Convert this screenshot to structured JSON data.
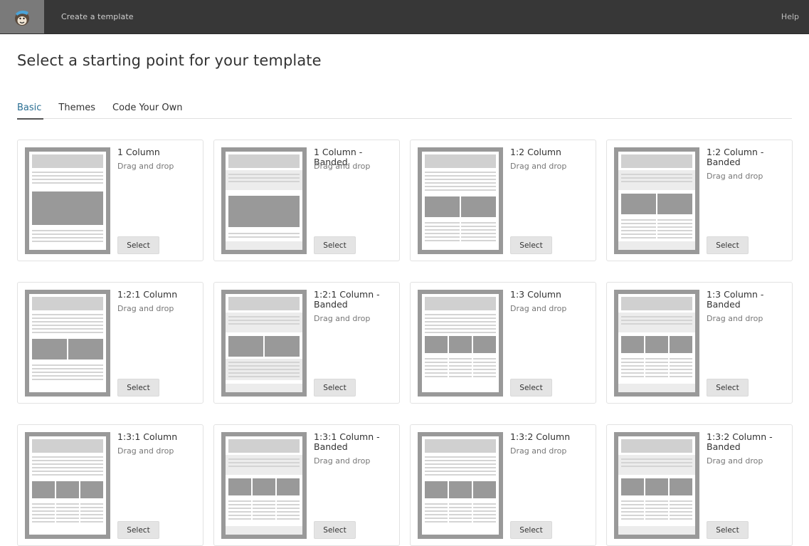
{
  "topbar": {
    "logo": "mailchimp-freddie-logo",
    "title": "Create a template",
    "help": "Help"
  },
  "page_title": "Select a starting point for your template",
  "tabs": [
    {
      "label": "Basic",
      "active": true
    },
    {
      "label": "Themes",
      "active": false
    },
    {
      "label": "Code Your Own",
      "active": false
    }
  ],
  "templates": [
    {
      "name": "1 Column",
      "subtitle": "Drag and drop",
      "button": "Select",
      "layout": "1",
      "banded": false
    },
    {
      "name": "1 Column - Banded",
      "subtitle": "Drag and drop",
      "button": "Select",
      "layout": "1",
      "banded": true
    },
    {
      "name": "1:2 Column",
      "subtitle": "Drag and drop",
      "button": "Select",
      "layout": "12",
      "banded": false
    },
    {
      "name": "1:2 Column - Banded",
      "subtitle": "Drag and drop",
      "button": "Select",
      "layout": "12",
      "banded": true
    },
    {
      "name": "1:2:1 Column",
      "subtitle": "Drag and drop",
      "button": "Select",
      "layout": "121",
      "banded": false
    },
    {
      "name": "1:2:1 Column - Banded",
      "subtitle": "Drag and drop",
      "button": "Select",
      "layout": "121",
      "banded": true
    },
    {
      "name": "1:3 Column",
      "subtitle": "Drag and drop",
      "button": "Select",
      "layout": "13",
      "banded": false
    },
    {
      "name": "1:3 Column - Banded",
      "subtitle": "Drag and drop",
      "button": "Select",
      "layout": "13",
      "banded": true
    },
    {
      "name": "1:3:1 Column",
      "subtitle": "Drag and drop",
      "button": "Select",
      "layout": "131",
      "banded": false
    },
    {
      "name": "1:3:1 Column - Banded",
      "subtitle": "Drag and drop",
      "button": "Select",
      "layout": "131",
      "banded": true
    },
    {
      "name": "1:3:2 Column",
      "subtitle": "Drag and drop",
      "button": "Select",
      "layout": "132",
      "banded": false
    },
    {
      "name": "1:3:2 Column - Banded",
      "subtitle": "Drag and drop",
      "button": "Select",
      "layout": "132",
      "banded": true
    }
  ],
  "colors": {
    "topbar": "#373737",
    "active_tab": "#2a6f93"
  }
}
